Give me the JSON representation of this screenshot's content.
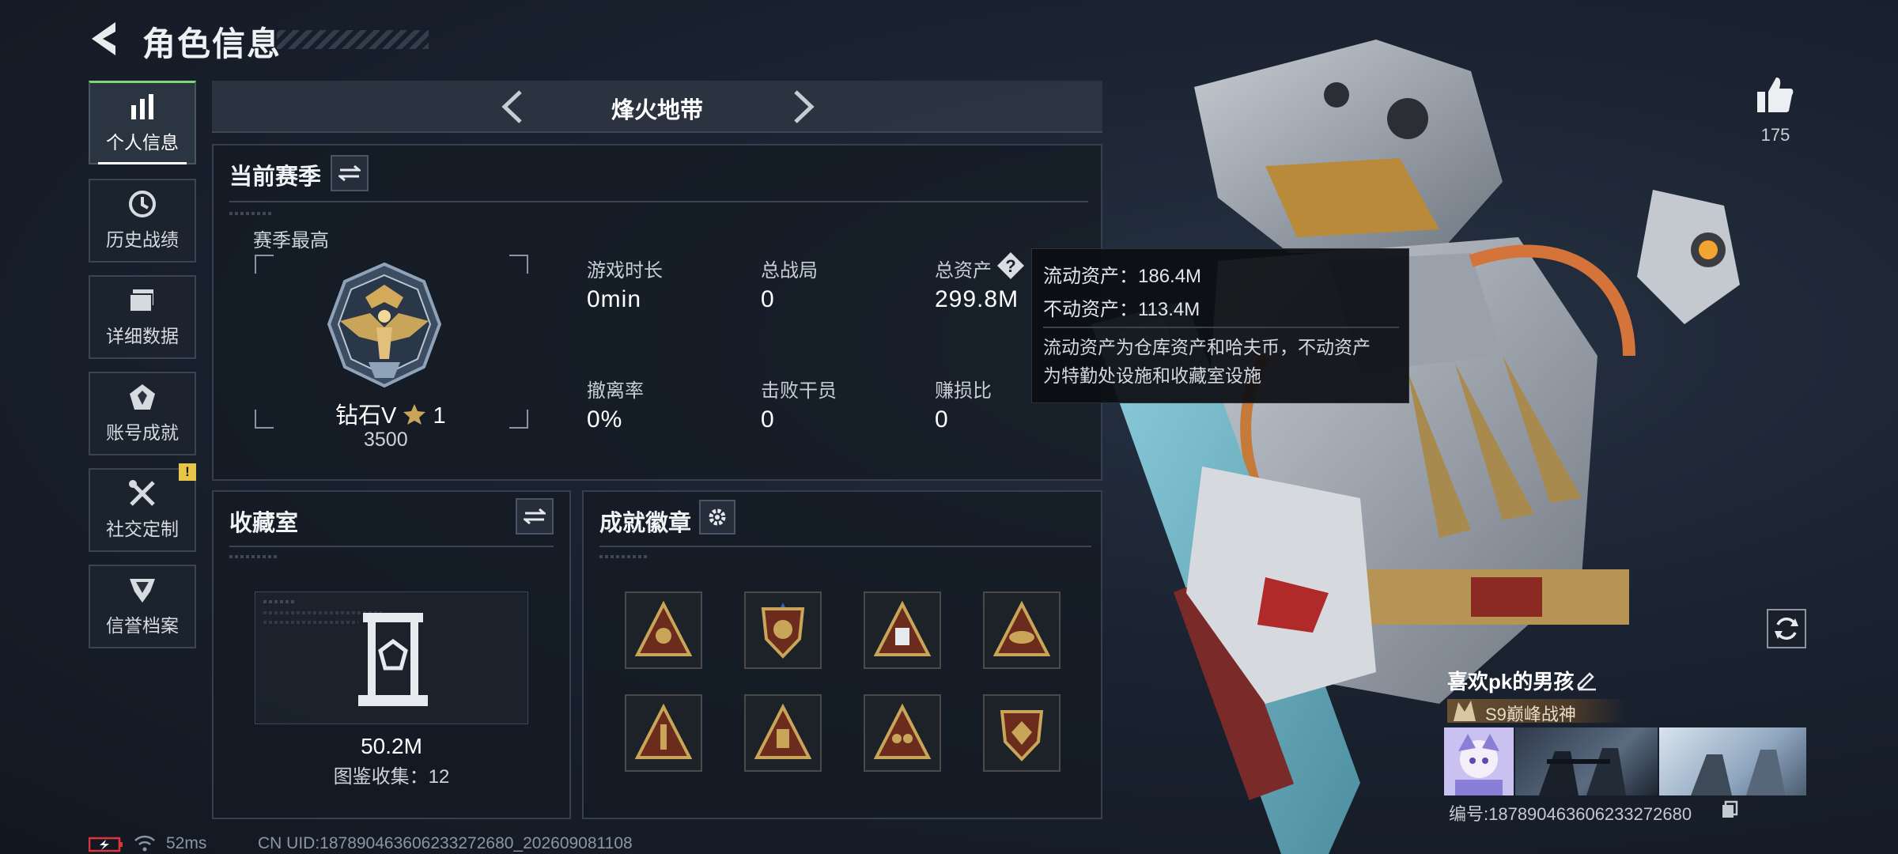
{
  "header": {
    "title": "角色信息"
  },
  "sidebar": {
    "items": [
      {
        "label": "个人信息",
        "icon": "bar-chart-icon"
      },
      {
        "label": "历史战绩",
        "icon": "history-icon"
      },
      {
        "label": "详细数据",
        "icon": "folder-icon"
      },
      {
        "label": "账号成就",
        "icon": "achievement-icon"
      },
      {
        "label": "社交定制",
        "icon": "tools-icon"
      },
      {
        "label": "信誉档案",
        "icon": "shield-icon"
      }
    ],
    "alert": "!"
  },
  "mode": {
    "title": "烽火地带"
  },
  "season": {
    "title": "当前赛季",
    "best_label": "赛季最高",
    "rank_name": "钻石V",
    "rank_stars": "1",
    "rank_score": "3500",
    "stats": [
      {
        "label": "游戏时长",
        "value": "0min"
      },
      {
        "label": "总战局",
        "value": "0"
      },
      {
        "label": "总资产",
        "value": "299.8M"
      },
      {
        "label": "撤离率",
        "value": "0%"
      },
      {
        "label": "击败干员",
        "value": "0"
      },
      {
        "label": "赚损比",
        "value": "0"
      }
    ]
  },
  "tooltip": {
    "line1": "流动资产：186.4M",
    "line2": "不动资产：113.4M",
    "desc1": "流动资产为仓库资产和哈夫币，不动资产",
    "desc2": "为特勤处设施和收藏室设施"
  },
  "collection": {
    "title": "收藏室",
    "value": "50.2M",
    "count_text": "图鉴收集：12"
  },
  "achievements": {
    "title": "成就徽章",
    "badge_count": 8
  },
  "profile": {
    "likes": "175",
    "name": "喜欢pk的男孩",
    "rank_tag": "S9巅峰战神",
    "id_text": "编号:187890463606233272680"
  },
  "footer": {
    "ping": "52ms",
    "uid": "CN UID:187890463606233272680_202609081108"
  },
  "colors": {
    "accent": "#7dd87c",
    "gold": "#c9a55a",
    "alert": "#e7c548",
    "battery": "#e0343a"
  }
}
